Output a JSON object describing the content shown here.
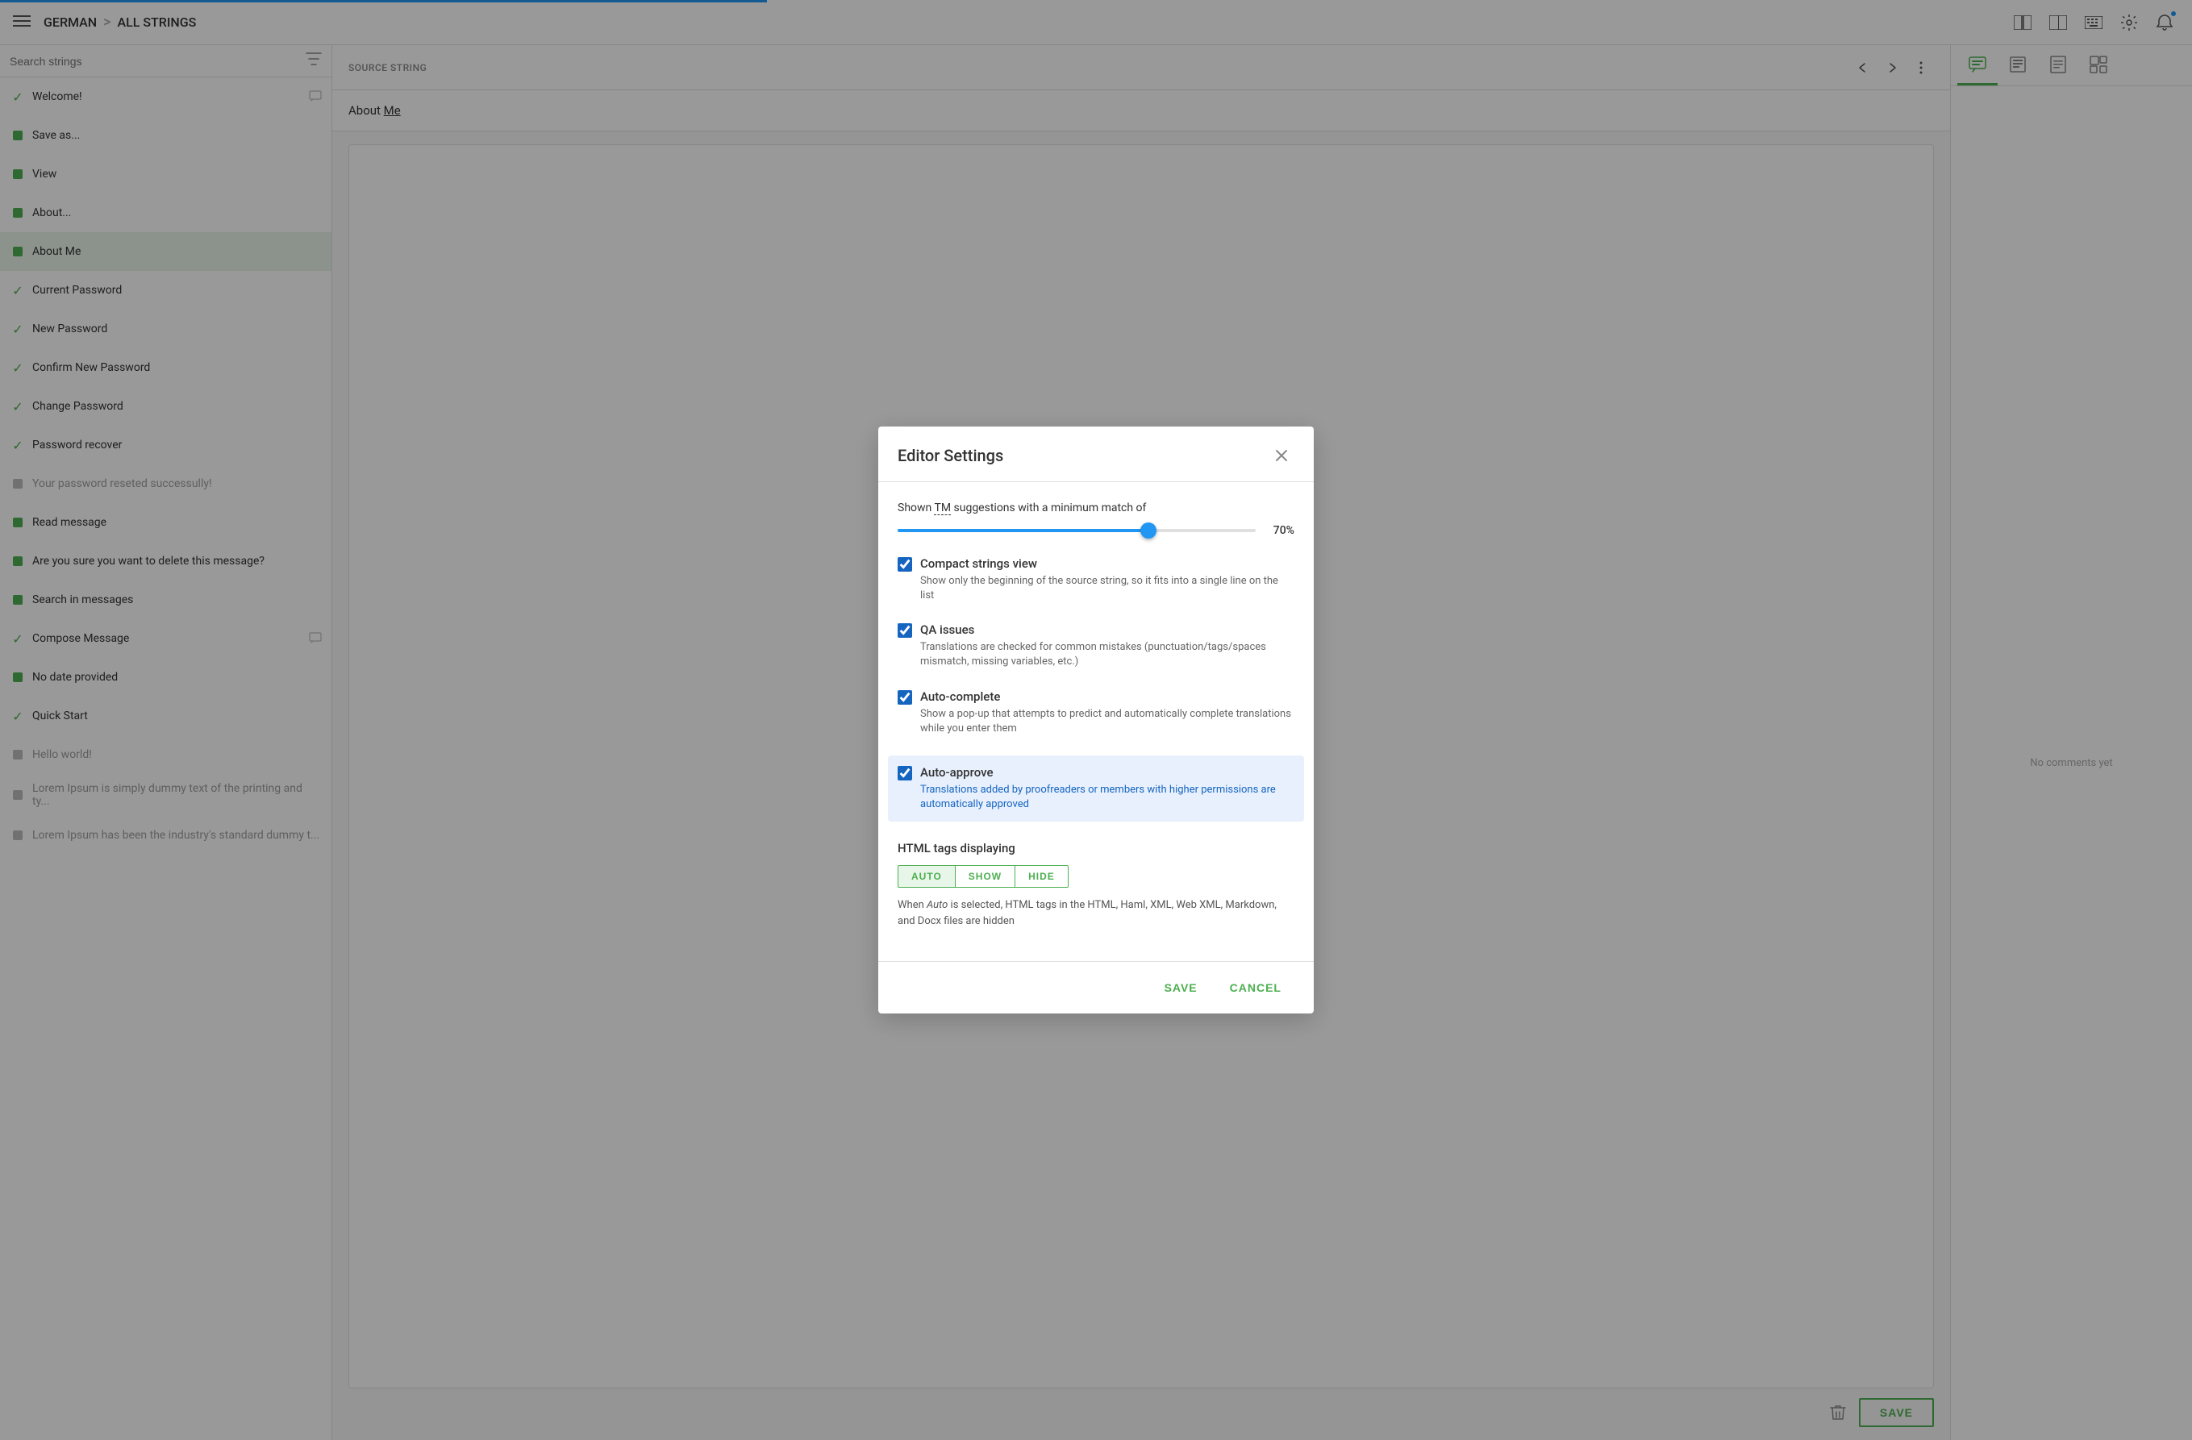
{
  "topbar": {
    "breadcrumb_start": "GERMAN",
    "breadcrumb_sep": ">",
    "breadcrumb_end": "ALL STRINGS",
    "progress_percent": 35,
    "icons": {
      "menu": "☰",
      "view1": "▦",
      "view2": "▤",
      "keyboard": "⌨",
      "gear": "⚙",
      "bell": "🔔"
    }
  },
  "sidebar": {
    "search_placeholder": "Search strings",
    "items": [
      {
        "status": "check",
        "label": "Welcome!",
        "has_comment": true,
        "dimmed": false
      },
      {
        "status": "dot",
        "label": "Save as...",
        "has_comment": false,
        "dimmed": false
      },
      {
        "status": "dot",
        "label": "View",
        "has_comment": false,
        "dimmed": false
      },
      {
        "status": "dot",
        "label": "About...",
        "has_comment": false,
        "dimmed": false
      },
      {
        "status": "dot",
        "label": "About Me",
        "has_comment": false,
        "dimmed": false,
        "active": true
      },
      {
        "status": "check",
        "label": "Current Password",
        "has_comment": false,
        "dimmed": false
      },
      {
        "status": "check",
        "label": "New Password",
        "has_comment": false,
        "dimmed": false
      },
      {
        "status": "check",
        "label": "Confirm New Password",
        "has_comment": false,
        "dimmed": false
      },
      {
        "status": "check",
        "label": "Change Password",
        "has_comment": false,
        "dimmed": false
      },
      {
        "status": "check",
        "label": "Password recover",
        "has_comment": false,
        "dimmed": false
      },
      {
        "status": "dot-gray",
        "label": "Your password reseted successully!",
        "has_comment": false,
        "dimmed": true
      },
      {
        "status": "dot",
        "label": "Read message",
        "has_comment": false,
        "dimmed": false
      },
      {
        "status": "dot",
        "label": "Are you sure you want to delete this message?",
        "has_comment": false,
        "dimmed": false
      },
      {
        "status": "dot",
        "label": "Search in messages",
        "has_comment": false,
        "dimmed": false
      },
      {
        "status": "check",
        "label": "Compose Message",
        "has_comment": true,
        "dimmed": false
      },
      {
        "status": "dot",
        "label": "No date provided",
        "has_comment": false,
        "dimmed": false
      },
      {
        "status": "check",
        "label": "Quick Start",
        "has_comment": false,
        "dimmed": false
      },
      {
        "status": "dot-gray",
        "label": "Hello world!",
        "has_comment": false,
        "dimmed": true
      },
      {
        "status": "dot-gray",
        "label": "Lorem Ipsum is simply dummy text of the printing and ty...",
        "has_comment": false,
        "dimmed": true
      },
      {
        "status": "dot-gray",
        "label": "Lorem Ipsum has been the industry's standard dummy t...",
        "has_comment": false,
        "dimmed": true
      }
    ]
  },
  "center": {
    "source_label": "SOURCE STRING",
    "source_value": "About Me",
    "source_value_underline_start": 6,
    "source_value_underline_end": 8
  },
  "right_panel": {
    "no_comments": "No comments yet",
    "tabs": [
      "comment",
      "history",
      "glossary",
      "qa"
    ]
  },
  "modal": {
    "title": "Editor Settings",
    "tm_label": "Shown TM suggestions with a minimum match of",
    "tm_value": "70%",
    "tm_percent": 70,
    "compact_strings": {
      "title": "Compact strings view",
      "desc": "Show only the beginning of the source string, so it fits into a single line on the list",
      "checked": true
    },
    "qa_issues": {
      "title": "QA issues",
      "desc": "Translations are checked for common mistakes (punctuation/tags/spaces mismatch, missing variables, etc.)",
      "checked": true
    },
    "auto_complete": {
      "title": "Auto-complete",
      "desc": "Show a pop-up that attempts to predict and automatically complete translations while you enter them",
      "checked": true
    },
    "auto_approve": {
      "title": "Auto-approve",
      "desc": "Translations added by proofreaders or members with higher permissions are automatically approved",
      "checked": true,
      "highlighted": true
    },
    "html_tags": {
      "title": "HTML tags displaying",
      "buttons": [
        "AUTO",
        "SHOW",
        "HIDE"
      ],
      "active_button": "AUTO",
      "desc": "When Auto is selected, HTML tags in the HTML, Haml, XML, Web XML, Markdown, and Docx files are hidden",
      "desc_italic": "Auto"
    },
    "save_label": "SAVE",
    "cancel_label": "CANCEL"
  }
}
